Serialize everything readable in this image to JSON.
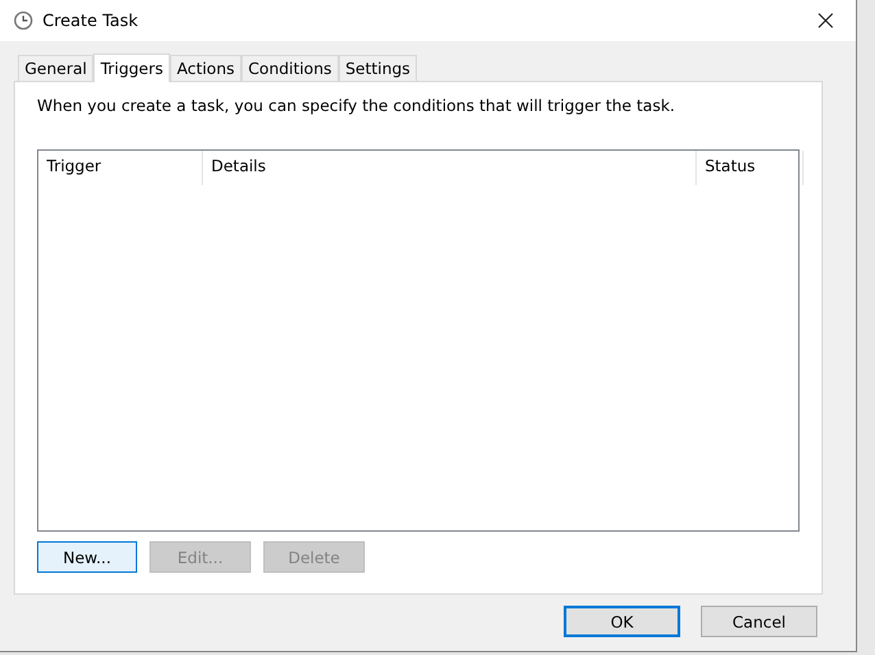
{
  "window": {
    "title": "Create Task"
  },
  "tabs": [
    {
      "label": "General",
      "selected": false
    },
    {
      "label": "Triggers",
      "selected": true
    },
    {
      "label": "Actions",
      "selected": false
    },
    {
      "label": "Conditions",
      "selected": false
    },
    {
      "label": "Settings",
      "selected": false
    }
  ],
  "description": "When you create a task, you can specify the conditions that will trigger the task.",
  "table": {
    "columns": [
      "Trigger",
      "Details",
      "Status"
    ]
  },
  "trigger_buttons": [
    {
      "label": "New...",
      "disabled": false,
      "focused": true
    },
    {
      "label": "Edit...",
      "disabled": true,
      "focused": false
    },
    {
      "label": "Delete",
      "disabled": true,
      "focused": false
    }
  ],
  "dialog_buttons": [
    {
      "label": "OK",
      "focused": true
    },
    {
      "label": "Cancel",
      "focused": false
    }
  ]
}
